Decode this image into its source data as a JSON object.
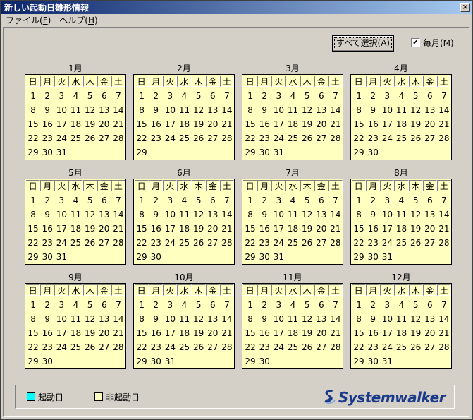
{
  "window": {
    "title": "新しい起動日雛形情報",
    "close": "×"
  },
  "menu": [
    {
      "label": "ファイル(",
      "key": "F",
      "tail": ")"
    },
    {
      "label": "ヘルプ(",
      "key": "H",
      "tail": ")"
    }
  ],
  "toolbar": {
    "select_all_label": "すべて選択(A)",
    "monthly_label": "毎月(M)",
    "monthly_checked": true
  },
  "weekdays": [
    "日",
    "月",
    "火",
    "水",
    "木",
    "金",
    "土"
  ],
  "months": [
    {
      "name": "1月",
      "days": 31
    },
    {
      "name": "2月",
      "days": 29
    },
    {
      "name": "3月",
      "days": 31
    },
    {
      "name": "4月",
      "days": 30
    },
    {
      "name": "5月",
      "days": 31
    },
    {
      "name": "6月",
      "days": 30
    },
    {
      "name": "7月",
      "days": 31
    },
    {
      "name": "8月",
      "days": 31
    },
    {
      "name": "9月",
      "days": 30
    },
    {
      "name": "10月",
      "days": 31
    },
    {
      "name": "11月",
      "days": 30
    },
    {
      "name": "12月",
      "days": 31
    }
  ],
  "legend": {
    "start_day_label": "起動日",
    "start_day_color": "#00ffff",
    "non_start_day_label": "非起動日",
    "non_start_day_color": "#ffffc0"
  },
  "logo_text": "Systemwalker",
  "colors": {
    "title_start": "#0a246a",
    "title_end": "#a6caf0",
    "calendar_bg": "#ffffc0"
  }
}
